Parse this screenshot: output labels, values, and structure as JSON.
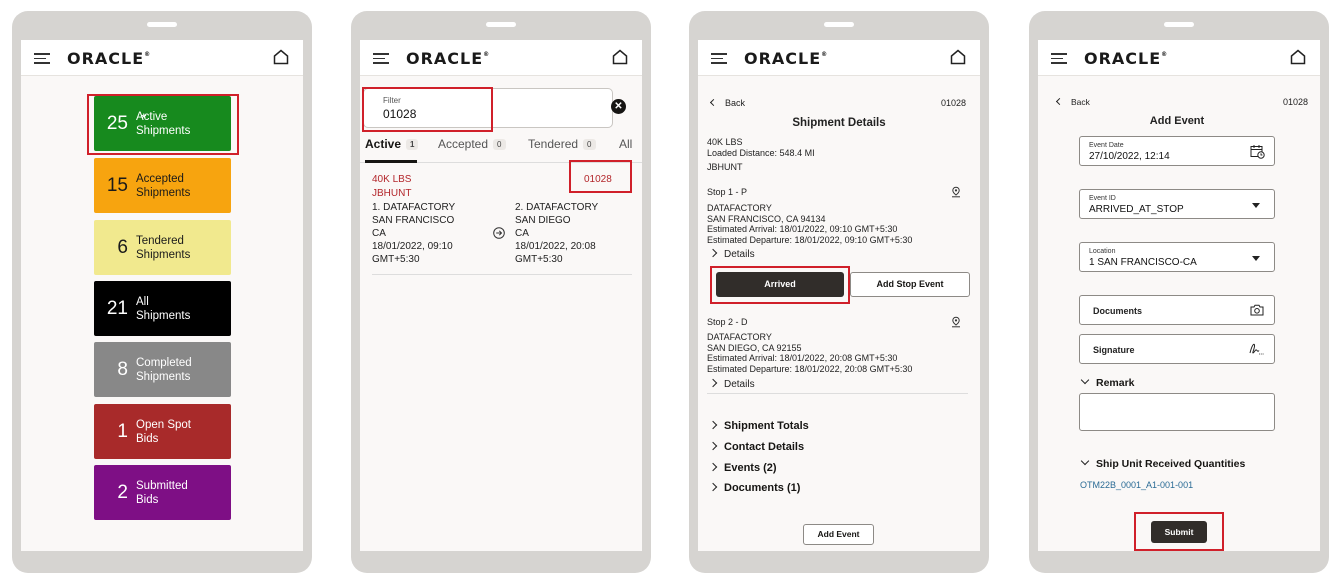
{
  "brand": {
    "logo": "ORACLE",
    "trademark": "®"
  },
  "screen1": {
    "tiles": [
      {
        "count": "25",
        "star": "*",
        "label1": "Active",
        "label2": "Shipments",
        "color": "#178a1e",
        "text": "#ffffff"
      },
      {
        "count": "15",
        "label1": "Accepted",
        "label2": "Shipments",
        "color": "#f7a40f",
        "text": "#1a1a1a"
      },
      {
        "count": "6",
        "label1": "Tendered",
        "label2": "Shipments",
        "color": "#f1e98e",
        "text": "#1a1a1a"
      },
      {
        "count": "21",
        "label1": "All",
        "label2": "Shipments",
        "color": "#000000",
        "text": "#ffffff"
      },
      {
        "count": "8",
        "label1": "Completed",
        "label2": "Shipments",
        "color": "#888888",
        "text": "#ffffff"
      },
      {
        "count": "1",
        "label1": "Open Spot",
        "label2": "Bids",
        "color": "#a82a2a",
        "text": "#ffffff"
      },
      {
        "count": "2",
        "label1": "Submitted",
        "label2": "Bids",
        "color": "#7e0f85",
        "text": "#ffffff"
      }
    ]
  },
  "screen2": {
    "filter": {
      "label": "Filter",
      "value": "01028"
    },
    "tabs": [
      {
        "label": "Active",
        "count": "1"
      },
      {
        "label": "Accepted",
        "count": "0"
      },
      {
        "label": "Tendered",
        "count": "0"
      },
      {
        "label": "All"
      }
    ],
    "shipment": {
      "weight": "40K LBS",
      "carrier": "JBHUNT",
      "id": "01028",
      "origin": {
        "name": "1. DATAFACTORY",
        "city": "SAN FRANCISCO",
        "state": "CA",
        "date": "18/01/2022, 09:10",
        "tz": "GMT+5:30"
      },
      "dest": {
        "name": "2. DATAFACTORY",
        "city": "SAN DIEGO",
        "state": "CA",
        "date": "18/01/2022, 20:08",
        "tz": "GMT+5:30"
      }
    }
  },
  "screen3": {
    "back": "Back",
    "id": "01028",
    "title": "Shipment Details",
    "weight": "40K LBS",
    "distance": "Loaded Distance: 548.4 MI",
    "carrier": "JBHUNT",
    "stop1": {
      "title": "Stop 1 - P",
      "name": "DATAFACTORY",
      "address": "SAN FRANCISCO, CA 94134",
      "arrival": "Estimated Arrival: 18/01/2022, 09:10 GMT+5:30",
      "departure": "Estimated Departure: 18/01/2022, 09:10 GMT+5:30",
      "details": "Details"
    },
    "arrived": "Arrived",
    "add_stop_event": "Add Stop Event",
    "stop2": {
      "title": "Stop 2 - D",
      "name": "DATAFACTORY",
      "address": "SAN DIEGO, CA 92155",
      "arrival": "Estimated Arrival: 18/01/2022, 20:08 GMT+5:30",
      "departure": "Estimated Departure: 18/01/2022, 20:08 GMT+5:30",
      "details": "Details"
    },
    "sections": [
      "Shipment Totals",
      "Contact Details",
      "Events (2)",
      "Documents (1)"
    ],
    "add_event": "Add Event"
  },
  "screen4": {
    "back": "Back",
    "id": "01028",
    "title": "Add Event",
    "event_date": {
      "label": "Event Date",
      "value": "27/10/2022, 12:14"
    },
    "event_id": {
      "label": "Event ID",
      "value": "ARRIVED_AT_STOP"
    },
    "location": {
      "label": "Location",
      "value": "1 SAN FRANCISCO-CA"
    },
    "documents": "Documents",
    "signature": "Signature",
    "remark": "Remark",
    "ship_unit": "Ship Unit Received Quantities",
    "ship_unit_link": "OTM22B_0001_A1-001-001",
    "submit": "Submit"
  },
  "colors": {
    "highlight": "#d0202a",
    "accent_red": "#b3262b",
    "dark_button": "#312d2a",
    "link": "#2a6b95"
  }
}
